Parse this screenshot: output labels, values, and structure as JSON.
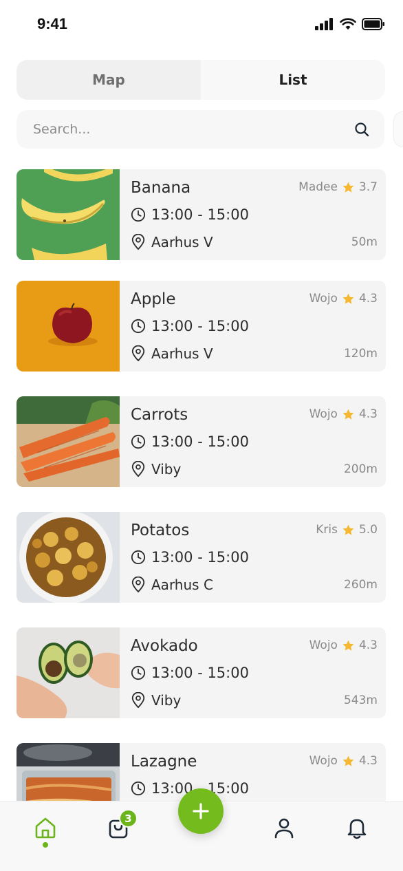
{
  "status_bar": {
    "time": "9:41"
  },
  "tabs": {
    "map": "Map",
    "list": "List",
    "active": "List"
  },
  "search": {
    "placeholder": "Search..."
  },
  "colors": {
    "accent": "#6cb41c",
    "star": "#f5b82e",
    "card_bg": "#f4f4f4"
  },
  "listings": [
    {
      "title": "Banana",
      "seller": "Madee",
      "rating": "3.7",
      "time": "13:00 - 15:00",
      "location": "Aarhus V",
      "distance": "50m"
    },
    {
      "title": "Apple",
      "seller": "Wojo",
      "rating": "4.3",
      "time": "13:00 - 15:00",
      "location": "Aarhus V",
      "distance": "120m"
    },
    {
      "title": "Carrots",
      "seller": "Wojo",
      "rating": "4.3",
      "time": "13:00 - 15:00",
      "location": "Viby",
      "distance": "200m"
    },
    {
      "title": "Potatos",
      "seller": "Kris",
      "rating": "5.0",
      "time": "13:00 - 15:00",
      "location": "Aarhus C",
      "distance": "260m"
    },
    {
      "title": "Avokado",
      "seller": "Wojo",
      "rating": "4.3",
      "time": "13:00 - 15:00",
      "location": "Viby",
      "distance": "543m"
    },
    {
      "title": "Lazagne",
      "seller": "Wojo",
      "rating": "4.3",
      "time": "13:00 - 15:00",
      "location": "",
      "distance": ""
    }
  ],
  "bottom_nav": {
    "items": [
      "home-icon",
      "shopping-bag-icon",
      "add-icon",
      "user-icon",
      "bell-icon"
    ],
    "cart_count": "3",
    "active": "home-icon"
  }
}
